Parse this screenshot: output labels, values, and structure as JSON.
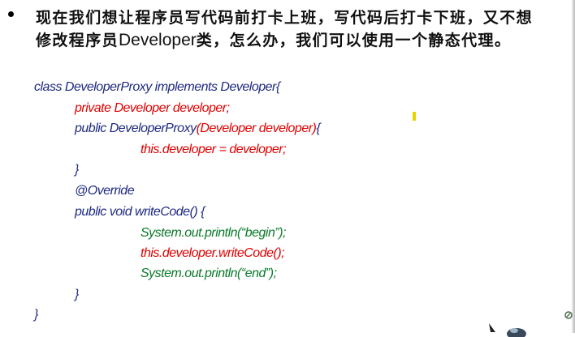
{
  "paragraph": {
    "line1": "现在我们想让程序员写代码前打卡上班，写代码后打卡下班，又不想",
    "line2_pre": "修改程序员",
    "line2_word": "Developer",
    "line2_post": "类，怎么办，我们可以使用一个静态代理。"
  },
  "code": {
    "l1": "class DeveloperProxy implements Developer{",
    "l2": "private Developer developer;",
    "l3a": "public DeveloperProxy",
    "l3b": "(Developer developer)",
    "l3c": "{",
    "l4": "this.developer = developer;",
    "l5": "}",
    "l6": "@Override",
    "l7": "public void writeCode() {",
    "l8": "System.out.println(“begin”);",
    "l9": "this.developer.writeCode();",
    "l10": "System.out.println(“end”);",
    "l11": "}",
    "l12": "}"
  },
  "colors": {
    "keyword": "#1f2a80",
    "field": "#e00000",
    "print": "#0b7a2a"
  },
  "icons": [
    "bullet-icon",
    "mouse-pointer-icon",
    "slide-corner-icon"
  ]
}
